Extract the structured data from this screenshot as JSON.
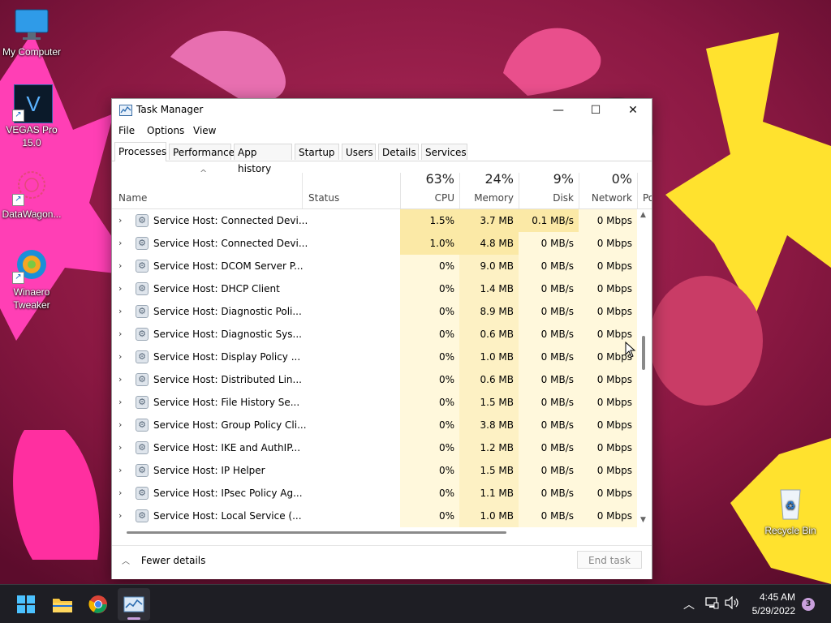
{
  "desktop": {
    "icons": [
      {
        "label": "My Computer",
        "icon": "monitor-icon"
      },
      {
        "label": "VEGAS Pro 15.0",
        "icon": "vegas-pro-icon",
        "glyph": "V"
      },
      {
        "label": "DataWagon...",
        "icon": "datawagon-icon"
      },
      {
        "label": "Winaero Tweaker",
        "icon": "winaero-tweaker-icon"
      },
      {
        "label": "Recycle Bin",
        "icon": "recycle-bin-icon"
      }
    ]
  },
  "window": {
    "title": "Task Manager",
    "controls": {
      "minimize": "—",
      "maximize": "☐",
      "close": "✕"
    },
    "menu": [
      "File",
      "Options",
      "View"
    ],
    "tabs": [
      "Processes",
      "Performance",
      "App history",
      "Startup",
      "Users",
      "Details",
      "Services"
    ],
    "active_tab": "Processes",
    "sort_arrow": "^",
    "columns": {
      "name": "Name",
      "status": "Status",
      "cpu": {
        "percent": "63%",
        "label": "CPU"
      },
      "memory": {
        "percent": "24%",
        "label": "Memory"
      },
      "disk": {
        "percent": "9%",
        "label": "Disk"
      },
      "network": {
        "percent": "0%",
        "label": "Network"
      },
      "power": "Po"
    },
    "rows": [
      {
        "name": "Service Host: Connected Devi...",
        "cpu": "1.5%",
        "mem": "3.7 MB",
        "disk": "0.1 MB/s",
        "net": "0 Mbps"
      },
      {
        "name": "Service Host: Connected Devi...",
        "cpu": "1.0%",
        "mem": "4.8 MB",
        "disk": "0 MB/s",
        "net": "0 Mbps"
      },
      {
        "name": "Service Host: DCOM Server P...",
        "cpu": "0%",
        "mem": "9.0 MB",
        "disk": "0 MB/s",
        "net": "0 Mbps"
      },
      {
        "name": "Service Host: DHCP Client",
        "cpu": "0%",
        "mem": "1.4 MB",
        "disk": "0 MB/s",
        "net": "0 Mbps"
      },
      {
        "name": "Service Host: Diagnostic Poli...",
        "cpu": "0%",
        "mem": "8.9 MB",
        "disk": "0 MB/s",
        "net": "0 Mbps"
      },
      {
        "name": "Service Host: Diagnostic Sys...",
        "cpu": "0%",
        "mem": "0.6 MB",
        "disk": "0 MB/s",
        "net": "0 Mbps"
      },
      {
        "name": "Service Host: Display Policy ...",
        "cpu": "0%",
        "mem": "1.0 MB",
        "disk": "0 MB/s",
        "net": "0 Mbps"
      },
      {
        "name": "Service Host: Distributed Lin...",
        "cpu": "0%",
        "mem": "0.6 MB",
        "disk": "0 MB/s",
        "net": "0 Mbps"
      },
      {
        "name": "Service Host: File History Se...",
        "cpu": "0%",
        "mem": "1.5 MB",
        "disk": "0 MB/s",
        "net": "0 Mbps"
      },
      {
        "name": "Service Host: Group Policy Cli...",
        "cpu": "0%",
        "mem": "3.8 MB",
        "disk": "0 MB/s",
        "net": "0 Mbps"
      },
      {
        "name": "Service Host: IKE and AuthIP...",
        "cpu": "0%",
        "mem": "1.2 MB",
        "disk": "0 MB/s",
        "net": "0 Mbps"
      },
      {
        "name": "Service Host: IP Helper",
        "cpu": "0%",
        "mem": "1.5 MB",
        "disk": "0 MB/s",
        "net": "0 Mbps"
      },
      {
        "name": "Service Host: IPsec Policy Ag...",
        "cpu": "0%",
        "mem": "1.1 MB",
        "disk": "0 MB/s",
        "net": "0 Mbps"
      },
      {
        "name": "Service Host: Local Service (...",
        "cpu": "0%",
        "mem": "1.0 MB",
        "disk": "0 MB/s",
        "net": "0 Mbps"
      }
    ],
    "footer": {
      "fewer_details": "Fewer details",
      "end_task": "End task"
    }
  },
  "taskbar": {
    "apps": [
      "start-icon",
      "file-explorer-icon",
      "chrome-icon",
      "task-manager-icon"
    ],
    "time": "4:45 AM",
    "date": "5/29/2022",
    "notification_count": "3"
  },
  "colors": {
    "heat_strong": "#fbe9a6",
    "heat_medium": "#fdf1c4",
    "heat_light": "#fff8dc",
    "wallpaper": "#7a1438",
    "taskbar": "#1e1e24"
  }
}
